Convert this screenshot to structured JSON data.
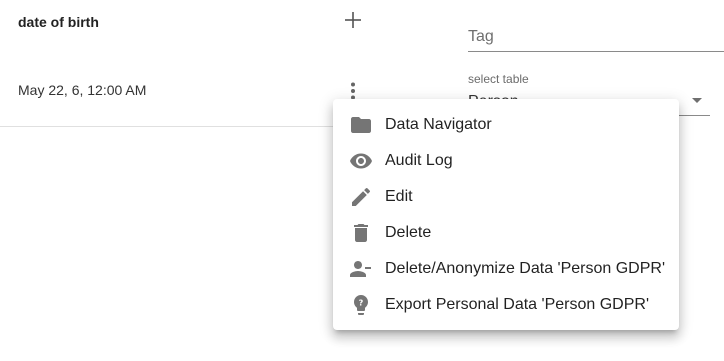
{
  "table": {
    "column_header": "date of birth",
    "row_value": "May 22, 6, 12:00 AM"
  },
  "tag_field": {
    "placeholder": "Tag",
    "value": ""
  },
  "select_table": {
    "label": "select table",
    "value": "Person"
  },
  "context_menu": {
    "items": [
      {
        "label": "Data Navigator",
        "icon": "folder-icon"
      },
      {
        "label": "Audit Log",
        "icon": "eye-icon"
      },
      {
        "label": "Edit",
        "icon": "pencil-icon"
      },
      {
        "label": "Delete",
        "icon": "trash-icon"
      },
      {
        "label": "Delete/Anonymize Data 'Person GDPR'",
        "icon": "person-remove-icon"
      },
      {
        "label": "Export Personal Data 'Person GDPR'",
        "icon": "person-question-icon"
      }
    ]
  },
  "colors": {
    "icon": "#757575",
    "divider": "#e0e0e0",
    "text": "#212121"
  }
}
